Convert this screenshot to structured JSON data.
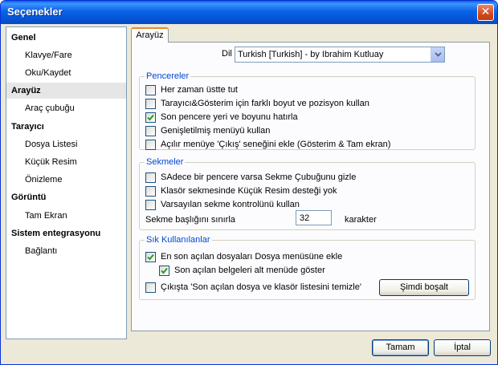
{
  "window": {
    "title": "Seçenekler",
    "close_glyph": "✕"
  },
  "nav": {
    "items": [
      {
        "label": "Genel",
        "kind": "category"
      },
      {
        "label": "Klavye/Fare",
        "kind": "sub"
      },
      {
        "label": "Oku/Kaydet",
        "kind": "sub"
      },
      {
        "label": "Arayüz",
        "kind": "category",
        "selected": true
      },
      {
        "label": "Araç çubuğu",
        "kind": "sub"
      },
      {
        "label": "Tarayıcı",
        "kind": "category"
      },
      {
        "label": "Dosya Listesi",
        "kind": "sub"
      },
      {
        "label": "Küçük Resim",
        "kind": "sub"
      },
      {
        "label": "Önizleme",
        "kind": "sub"
      },
      {
        "label": "Görüntü",
        "kind": "category"
      },
      {
        "label": "Tam Ekran",
        "kind": "sub"
      },
      {
        "label": "Sistem entegrasyonu",
        "kind": "category"
      },
      {
        "label": "Bağlantı",
        "kind": "sub"
      }
    ]
  },
  "tab": {
    "label": "Arayüz"
  },
  "language": {
    "label": "Dil",
    "value": "Turkish [Turkish] - by Ibrahim Kutluay"
  },
  "groups": {
    "windows": {
      "title": "Pencereler",
      "items": [
        {
          "label": "Her zaman üstte tut",
          "checked": false
        },
        {
          "label": "Tarayıcı&Gösterim için farklı boyut ve pozisyon kullan",
          "checked": false
        },
        {
          "label": "Son pencere yeri ve boyunu hatırla",
          "checked": true
        },
        {
          "label": "Genişletilmiş menüyü kullan",
          "checked": false
        },
        {
          "label": "Açılır menüye 'Çıkış' seneğini ekle (Gösterim & Tam ekran)",
          "checked": false
        }
      ]
    },
    "tabs": {
      "title": "Sekmeler",
      "items": [
        {
          "label": "SAdece bir pencere varsa Sekme Çubuğunu gizle",
          "checked": false
        },
        {
          "label": "Klasör sekmesinde Küçük Resim desteği yok",
          "checked": false
        },
        {
          "label": "Varsayılan sekme kontrolünü kullan",
          "checked": false
        }
      ],
      "limit_label": "Sekme başlığını sınırla",
      "limit_value": "32",
      "limit_unit": "karakter"
    },
    "recent": {
      "title": "Sık Kullanılanlar",
      "items": [
        {
          "label": "En son açılan dosyaları Dosya menüsüne ekle",
          "checked": true
        },
        {
          "label": "Son açılan belgeleri alt menüde göster",
          "checked": true
        },
        {
          "label": "Çıkışta 'Son açılan dosya ve klasör listesini temizle'",
          "checked": false
        }
      ],
      "clear_button": "Şimdi boşalt"
    }
  },
  "buttons": {
    "ok": "Tamam",
    "cancel": "İptal"
  }
}
